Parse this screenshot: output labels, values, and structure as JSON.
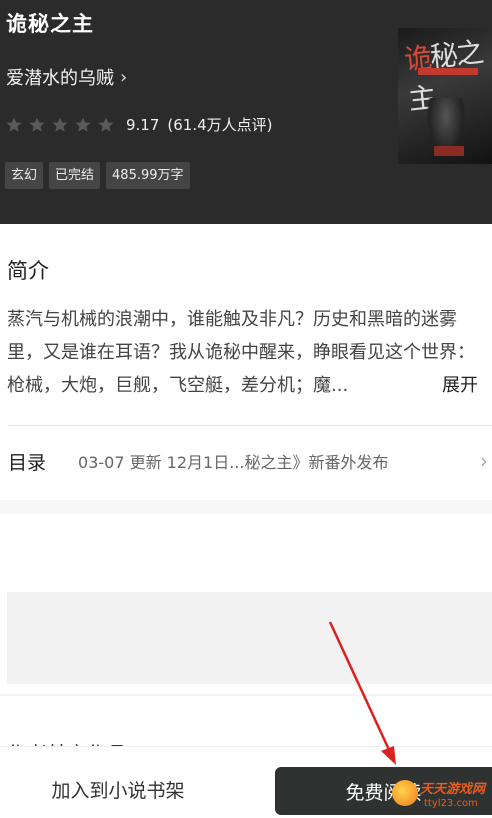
{
  "book": {
    "title": "诡秘之主",
    "author": "爱潜水的乌贼",
    "author_chevron": "›",
    "rating_score": "9.17",
    "rating_count": "(61.4万人点评)",
    "stars_filled": 0,
    "stars_total": 5,
    "tags": [
      "玄幻",
      "已完结",
      "485.99万字"
    ]
  },
  "cover": {
    "title_part1": "诡",
    "title_part2": "秘之主"
  },
  "intro": {
    "heading": "简介",
    "text": "蒸汽与机械的浪潮中，谁能触及非凡？历史和黑暗的迷雾里，又是谁在耳语？我从诡秘中醒来，睁眼看见这个世界：枪械，大炮，巨舰，飞空艇，差分机；魔...",
    "expand": "展开"
  },
  "toc": {
    "label": "目录",
    "update": "03-07  更新  12月1日...秘之主》新番外发布",
    "chevron": "›"
  },
  "more_section": {
    "partial_heading": "作者其它作品"
  },
  "actions": {
    "add_to_shelf": "加入到小说书架",
    "read_free": "免费阅读"
  },
  "watermark": {
    "brand": "天天游戏网",
    "url": "ttyl23.com"
  },
  "colors": {
    "header_bg": "#2b2b2b",
    "star": "#5a5a5a",
    "primary_button": "#2e3332",
    "annotation_arrow": "#e02020"
  },
  "icons": [
    "star-icon",
    "chevron-right-icon",
    "arrow-annotation"
  ]
}
